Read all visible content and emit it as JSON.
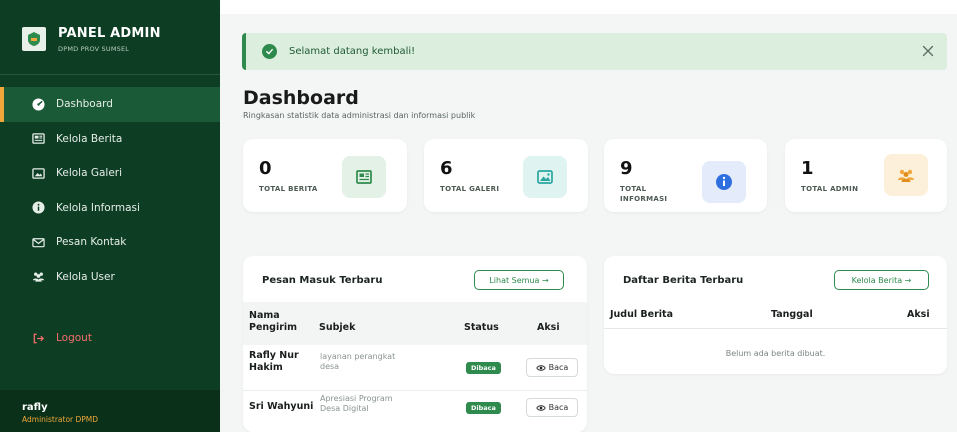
{
  "sidebar": {
    "brand_title": "PANEL ADMIN",
    "brand_subtitle": "DPMD PROV SUMSEL",
    "items": [
      {
        "label": "Dashboard",
        "icon": "dashboard-icon",
        "active": true
      },
      {
        "label": "Kelola Berita",
        "icon": "newspaper-icon"
      },
      {
        "label": "Kelola Galeri",
        "icon": "image-icon"
      },
      {
        "label": "Kelola Informasi",
        "icon": "info-icon"
      },
      {
        "label": "Pesan Kontak",
        "icon": "envelope-icon"
      },
      {
        "label": "Kelola User",
        "icon": "users-icon"
      }
    ],
    "logout_label": "Logout",
    "user": {
      "name": "rafly",
      "role": "Administrator DPMD"
    }
  },
  "alert": {
    "text": "Selamat datang kembali!"
  },
  "header": {
    "title": "Dashboard",
    "subtitle": "Ringkasan statistik data administrasi dan informasi publik"
  },
  "stats": [
    {
      "value": "0",
      "label": "TOTAL BERITA",
      "icon": "newspaper-icon",
      "color": "#2f8a4e"
    },
    {
      "value": "6",
      "label": "TOTAL GALERI",
      "icon": "image-icon",
      "color": "#2aa6a0"
    },
    {
      "value": "9",
      "label_line1": "TOTAL",
      "label_line2": "INFORMASI",
      "icon": "info-icon",
      "color": "#2e6fe0"
    },
    {
      "value": "1",
      "label": "TOTAL ADMIN",
      "icon": "users-icon",
      "color": "#f0a73a"
    }
  ],
  "messages": {
    "title": "Pesan Masuk Terbaru",
    "button": "Lihat Semua →",
    "columns": {
      "name_line1": "Nama",
      "name_line2": "Pengirim",
      "subject": "Subjek",
      "status": "Status",
      "action": "Aksi"
    },
    "rows": [
      {
        "name_line1": "Rafly Nur",
        "name_line2": "Hakim",
        "subject_line1": "layanan perangkat",
        "subject_line2": "desa",
        "status": "Dibaca",
        "action": "Baca"
      },
      {
        "name_line1": "Sri Wahyuni",
        "name_line2": "",
        "subject_line1": "Apresiasi Program",
        "subject_line2": "Desa Digital",
        "status": "Dibaca",
        "action": "Baca"
      }
    ]
  },
  "news": {
    "title": "Daftar Berita Terbaru",
    "button": "Kelola Berita →",
    "columns": {
      "title": "Judul Berita",
      "date": "Tanggal",
      "action": "Aksi"
    },
    "empty": "Belum ada berita dibuat."
  }
}
